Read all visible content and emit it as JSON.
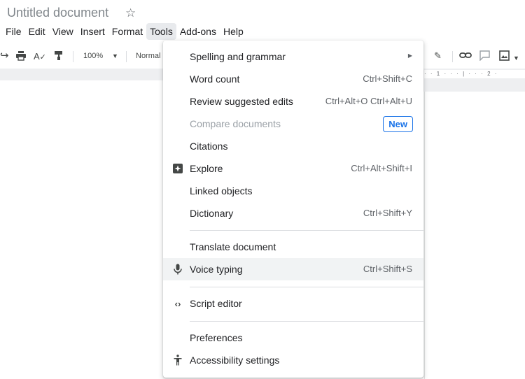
{
  "document": {
    "title": "Untitled document"
  },
  "menubar": {
    "items": [
      {
        "label": "File"
      },
      {
        "label": "Edit"
      },
      {
        "label": "View"
      },
      {
        "label": "Insert"
      },
      {
        "label": "Format"
      },
      {
        "label": "Tools",
        "active": true
      },
      {
        "label": "Add-ons"
      },
      {
        "label": "Help"
      }
    ]
  },
  "toolbar": {
    "zoom": "100%",
    "style": "Normal",
    "ruler_text": "· · 1 · · · | · · · 2 ·"
  },
  "tools_menu": {
    "items": [
      {
        "label": "Spelling and grammar",
        "has_submenu": true,
        "submenu_icon": "arrow-right-icon"
      },
      {
        "label": "Word count",
        "shortcut": "Ctrl+Shift+C"
      },
      {
        "label": "Review suggested edits",
        "shortcut": "Ctrl+Alt+O Ctrl+Alt+U"
      },
      {
        "label": "Compare documents",
        "disabled": true,
        "badge": "New"
      },
      {
        "label": "Citations"
      },
      {
        "label": "Explore",
        "shortcut": "Ctrl+Alt+Shift+I",
        "icon": "explore-icon"
      },
      {
        "label": "Linked objects"
      },
      {
        "label": "Dictionary",
        "shortcut": "Ctrl+Shift+Y"
      },
      {
        "label": "Translate document"
      },
      {
        "label": "Voice typing",
        "shortcut": "Ctrl+Shift+S",
        "icon": "microphone-icon",
        "highlighted": true
      },
      {
        "label": "Script editor",
        "icon": "code-icon"
      },
      {
        "label": "Preferences"
      },
      {
        "label": "Accessibility settings",
        "icon": "accessibility-icon"
      }
    ]
  },
  "colors": {
    "accent": "#1a73e8",
    "hover_bg": "#f1f3f4",
    "disabled_text": "#9aa0a6",
    "divider": "#dadce0"
  }
}
